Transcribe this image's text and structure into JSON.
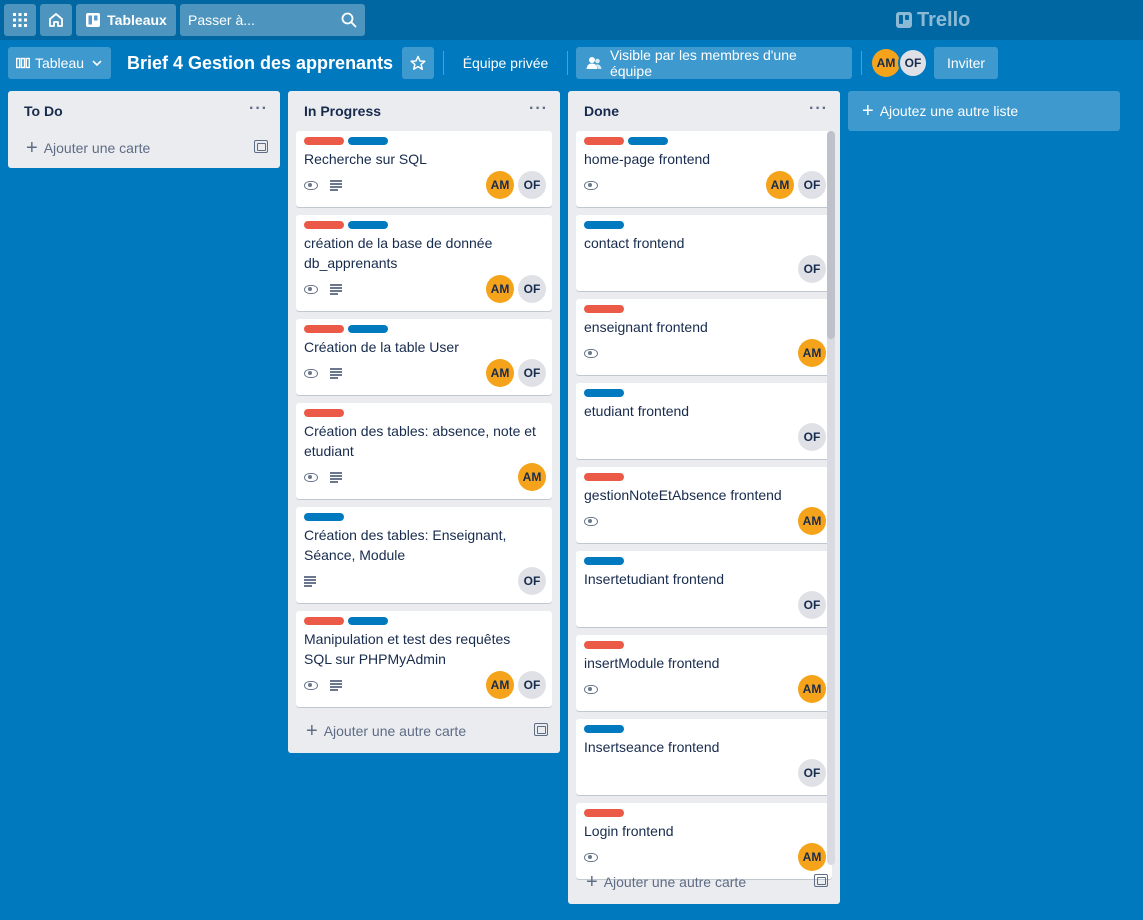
{
  "topbar": {
    "apps_icon": "grid-icon",
    "home_icon": "home-icon",
    "boards_label": "Tableaux",
    "search_placeholder": "Passer à...",
    "brand": "Trello"
  },
  "board": {
    "view_label": "Tableau",
    "title": "Brief 4 Gestion des apprenants",
    "team_label": "Équipe privée",
    "visibility_label": "Visible par les membres d'une équipe",
    "members": [
      "AM",
      "OF"
    ],
    "invite_label": "Inviter"
  },
  "colors": {
    "background": "#0079bf",
    "label_red": "#eb5a46",
    "label_blue": "#0079bf",
    "avatar_am": "#f6a31c",
    "avatar_of": "#dfe1e6"
  },
  "lists": [
    {
      "title": "To Do",
      "add_label": "Ajouter une carte",
      "cards": []
    },
    {
      "title": "In Progress",
      "add_label": "Ajouter une autre carte",
      "cards": [
        {
          "labels": [
            "red",
            "blue"
          ],
          "title": "Recherche sur SQL",
          "watch": true,
          "description": true,
          "members": [
            "AM",
            "OF"
          ]
        },
        {
          "labels": [
            "red",
            "blue"
          ],
          "title": "création de la base de donnée db_apprenants",
          "watch": true,
          "description": true,
          "members": [
            "AM",
            "OF"
          ]
        },
        {
          "labels": [
            "red",
            "blue"
          ],
          "title": "Création de la table User",
          "watch": true,
          "description": true,
          "members": [
            "AM",
            "OF"
          ]
        },
        {
          "labels": [
            "red"
          ],
          "title": "Création des tables: absence, note et etudiant",
          "watch": true,
          "description": true,
          "members": [
            "AM"
          ]
        },
        {
          "labels": [
            "blue"
          ],
          "title": "Création des tables: Enseignant, Séance, Module",
          "watch": false,
          "description": true,
          "members": [
            "OF"
          ]
        },
        {
          "labels": [
            "red",
            "blue"
          ],
          "title": "Manipulation et test des requêtes SQL sur PHPMyAdmin",
          "watch": true,
          "description": true,
          "members": [
            "AM",
            "OF"
          ]
        }
      ]
    },
    {
      "title": "Done",
      "add_label": "Ajouter une autre carte",
      "cards": [
        {
          "labels": [
            "red",
            "blue"
          ],
          "title": "home-page frontend",
          "watch": true,
          "description": false,
          "members": [
            "AM",
            "OF"
          ]
        },
        {
          "labels": [
            "blue"
          ],
          "title": "contact frontend",
          "watch": false,
          "description": false,
          "members": [
            "OF"
          ]
        },
        {
          "labels": [
            "red"
          ],
          "title": "enseignant frontend",
          "watch": true,
          "description": false,
          "members": [
            "AM"
          ]
        },
        {
          "labels": [
            "blue"
          ],
          "title": "etudiant frontend",
          "watch": false,
          "description": false,
          "members": [
            "OF"
          ]
        },
        {
          "labels": [
            "red"
          ],
          "title": "gestionNoteEtAbsence frontend",
          "watch": true,
          "description": false,
          "members": [
            "AM"
          ]
        },
        {
          "labels": [
            "blue"
          ],
          "title": "Insertetudiant frontend",
          "watch": false,
          "description": false,
          "members": [
            "OF"
          ]
        },
        {
          "labels": [
            "red"
          ],
          "title": "insertModule frontend",
          "watch": true,
          "description": false,
          "members": [
            "AM"
          ]
        },
        {
          "labels": [
            "blue"
          ],
          "title": "Insertseance frontend",
          "watch": false,
          "description": false,
          "members": [
            "OF"
          ]
        },
        {
          "labels": [
            "red"
          ],
          "title": "Login frontend",
          "watch": true,
          "description": false,
          "members": [
            "AM"
          ]
        }
      ]
    }
  ],
  "add_list_label": "Ajoutez une autre liste"
}
